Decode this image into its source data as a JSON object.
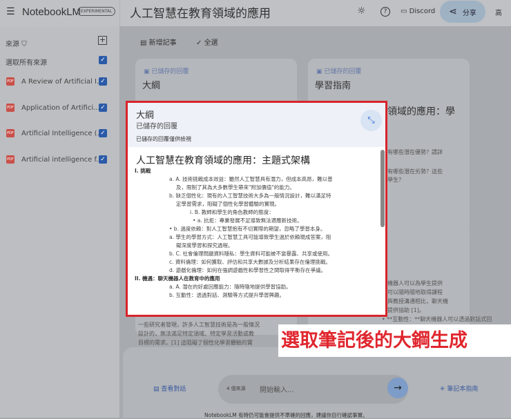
{
  "header": {
    "app_name": "NotebookLM",
    "badge": "EXPERIMENTAL",
    "notebook_title": "人工智慧在教育領域的應用",
    "discord": "Discord",
    "share": "分享",
    "avatar": "高"
  },
  "sidebar": {
    "sources_label": "來源",
    "select_all": "選取所有來源",
    "sources": [
      {
        "name": "A Review of Artificial I..."
      },
      {
        "name": "Application of Artifici..."
      },
      {
        "name": "Artificial Intelligence (..."
      },
      {
        "name": "Artificial intelligence f..."
      }
    ]
  },
  "toolbar": {
    "add_note": "新增記事",
    "select_all": "全選"
  },
  "cards": [
    {
      "tag": "已儲存的回覆",
      "title": "大綱"
    },
    {
      "tag": "已儲存的回覆",
      "title": "學習指南",
      "heading": "領域的應用：學",
      "q1": "有哪些潛在優勢？請詳",
      "q2": "有哪些潛在劣勢？這些",
      "q3": "學生？"
    }
  ],
  "bg_text": {
    "right": [
      "機器人可以為學生提供",
      "可以隨時隨地取得課程",
      "與教授溝通相比，聊天機",
      "提供協助 [1]。",
      "• **互動性：**聊天機器人可以透過對話式回"
    ],
    "left": [
      "一些研究者發現，許多人工智慧技術是為一般情況",
      "設計的，無法滿足特定領域、特定學習活動或教",
      "目標的需求。[1] 這阻礙了個性化學習體驗的實"
    ]
  },
  "overlay": {
    "title": "大綱",
    "subtitle": "已儲存的回覆",
    "notice": "已儲存的回覆僅供檢視",
    "heading": "人工智慧在教育領域的應用：主題式架構",
    "lines": [
      {
        "lvl": "h",
        "text": "I. 挑戰"
      },
      {
        "lvl": "l1",
        "text": "a. A. 技術挑戰成本效益：雖然人工智慧具有潛力，但成本高昂，難以普"
      },
      {
        "lvl": "cont",
        "text": "及，限制了其為大多數學生帶來\"附加價值\"的能力。"
      },
      {
        "lvl": "l1",
        "text": "b. 缺乏個性化：現有的人工智慧技術大多為一般情況設計，難以滿足特"
      },
      {
        "lvl": "cont",
        "text": "定學習需求，阻礙了個性化學習體驗的實現。"
      },
      {
        "lvl": "l2",
        "text": "i. B. 教師和學生的角色教師的態度："
      },
      {
        "lvl": "l3",
        "text": "• a. 抗拒：專業發展不足導致無法適應新技術。"
      },
      {
        "lvl": "l1",
        "text": "• b. 過度依賴：對人工智慧抱有不切實際的期望，忽略了學習本身。"
      },
      {
        "lvl": "l1",
        "text": "a. 學生的學習方式：人工智慧工具可能導致學生過於依賴現成答案，阻"
      },
      {
        "lvl": "cont",
        "text": "礙深度學習和探究過程。"
      },
      {
        "lvl": "l1",
        "text": "b. C. 社會倫理問題資料隱私：學生資料可能被不當暴露、共享或使用。"
      },
      {
        "lvl": "l1",
        "text": "c. 資料倫理：如何獲取、評估和共享大數據及分析結果存在倫理挑戰。"
      },
      {
        "lvl": "l1",
        "text": "d. 遊戲化倫理：如何在強調遊戲性和學習性之間取得平衡存在爭議。"
      },
      {
        "lvl": "h",
        "text": "II. 機遇：聊天機器人在教育中的應用"
      },
      {
        "lvl": "l1",
        "text": "a. A. 潛在的好處回應能力：隨時隨地提供學習協助。"
      },
      {
        "lvl": "l1",
        "text": "b. 互動性：透過對話、測驗等方式提升學習興趣。"
      }
    ]
  },
  "annotation": "選取筆記後的大鋼生成",
  "chat": {
    "view_chat": "查看對話",
    "source_count": "4 個來源",
    "placeholder": "開始輸入...",
    "guide": "筆記本指南",
    "disclaimer": "NotebookLM 有時仍可能會提供不準確的回應，建議你自行確認事實。"
  }
}
